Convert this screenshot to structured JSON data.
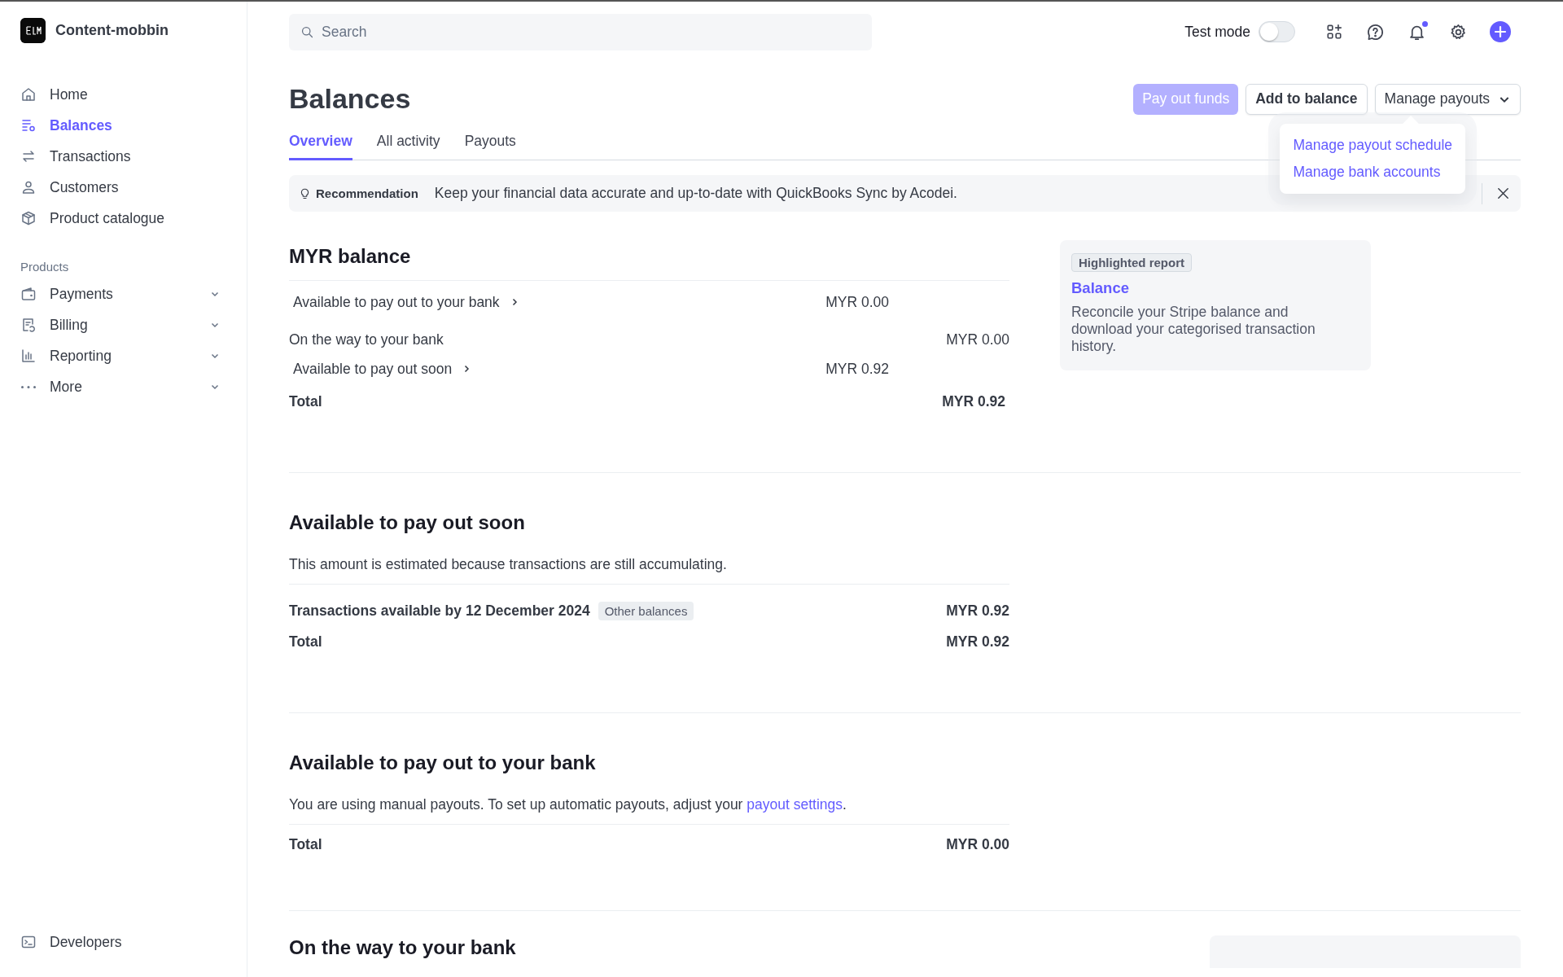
{
  "sidebar": {
    "account": {
      "name": "Content-mobbin"
    },
    "nav": [
      {
        "label": "Home",
        "selected": false
      },
      {
        "label": "Balances",
        "selected": true
      },
      {
        "label": "Transactions",
        "selected": false
      },
      {
        "label": "Customers",
        "selected": false
      },
      {
        "label": "Product catalogue",
        "selected": false
      }
    ],
    "section_label": "Products",
    "products": [
      {
        "label": "Payments",
        "expanded": false
      },
      {
        "label": "Billing",
        "expanded": false
      },
      {
        "label": "Reporting",
        "expanded": false
      },
      {
        "label": "More",
        "expanded": false
      }
    ],
    "footer": [
      {
        "label": "Developers"
      }
    ]
  },
  "topbar": {
    "search": {
      "placeholder": "Search"
    },
    "test_mode": {
      "label": "Test mode",
      "on": false
    },
    "notification_unread": true
  },
  "header": {
    "title": "Balances",
    "buttons": [
      {
        "label": "Pay out funds",
        "kind": "primary",
        "disabled": true
      },
      {
        "label": "Add to balance",
        "kind": "secondary",
        "disabled": false
      },
      {
        "label": "Manage payouts",
        "kind": "dropdown",
        "disabled": false
      }
    ],
    "menu": {
      "open": true,
      "items": [
        "Manage payout schedule",
        "Manage bank accounts"
      ]
    },
    "tabs": [
      {
        "label": "Overview",
        "selected": true
      },
      {
        "label": "All activity",
        "selected": false
      },
      {
        "label": "Payouts",
        "selected": false
      }
    ]
  },
  "recommendation": {
    "label": "Recommendation",
    "text": "Keep your financial data accurate and up-to-date with QuickBooks Sync by Acodei."
  },
  "myr_balance": {
    "title": "MYR balance",
    "rows": [
      {
        "label": "Available to pay out to your bank",
        "amount": "MYR 0.00",
        "kind": "link"
      },
      {
        "label": "On the way to your bank",
        "amount": "MYR 0.00",
        "kind": "plain"
      },
      {
        "label": "Available to pay out soon",
        "amount": "MYR 0.92",
        "kind": "link"
      }
    ],
    "total": {
      "label": "Total",
      "amount": "MYR 0.92"
    }
  },
  "highlighted_report": {
    "badge": "Highlighted report",
    "title": "Balance",
    "text": "Reconcile your Stripe balance and download your categorised transaction history."
  },
  "sections": [
    {
      "title": "Available to pay out soon",
      "description": "This amount is estimated because transactions are still accumulating.",
      "rows": [
        {
          "label": "Transactions available by 12 December 2024",
          "tag": "Other balances",
          "amount": "MYR 0.92"
        }
      ],
      "total": {
        "label": "Total",
        "amount": "MYR 0.92"
      }
    },
    {
      "title": "Available to pay out to your bank",
      "description": "You are using manual payouts. To set up automatic payouts, adjust your",
      "link": "payout settings",
      "description_end": ".",
      "total": {
        "label": "Total",
        "amount": "MYR 0.00"
      }
    },
    {
      "title": "On the way to your bank"
    }
  ]
}
